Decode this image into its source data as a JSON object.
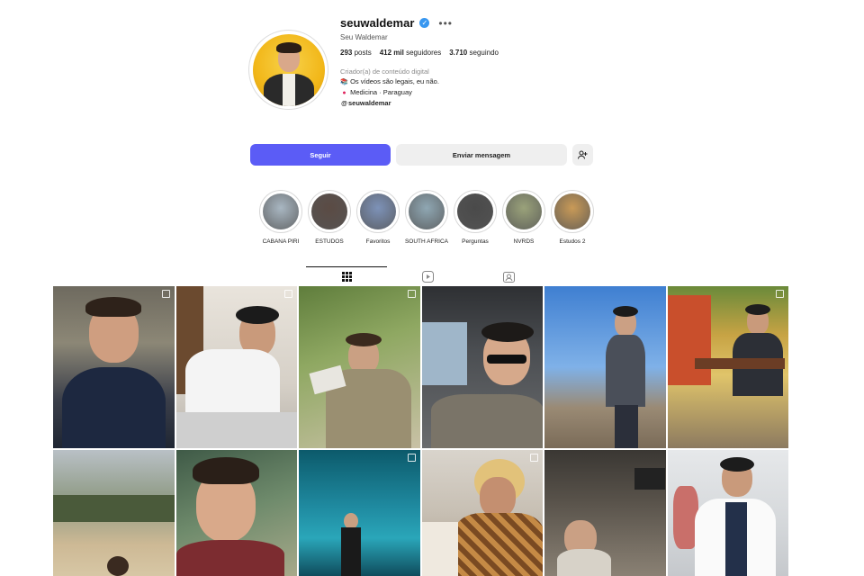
{
  "profile": {
    "username": "seuwaldemar",
    "full_name": "Seu Waldemar",
    "posts_count": "293",
    "posts_label": "posts",
    "followers_count": "412 mil",
    "followers_label": "seguidores",
    "following_count": "3.710",
    "following_label": "seguindo",
    "category": "Criador(a) de conteúdo digital",
    "bio_line1": "Os vídeos são legais, eu não.",
    "bio_line2": "Medicina · Paraguay",
    "threads_handle": "seuwaldemar"
  },
  "actions": {
    "follow_label": "Seguir",
    "message_label": "Enviar mensagem",
    "add_icon": "person-add-icon"
  },
  "highlights": [
    {
      "label": "CABANA PIRI",
      "color": "#a9b7c2"
    },
    {
      "label": "ESTUDOS",
      "color": "#5b4b44"
    },
    {
      "label": "Favoritos",
      "color": "#7d92b8"
    },
    {
      "label": "SOUTH AFRICA",
      "color": "#8fa7b3"
    },
    {
      "label": "Perguntas",
      "color": "#4a4a4a"
    },
    {
      "label": "NVRDS",
      "color": "#9aa27a"
    },
    {
      "label": "Estudos 2",
      "color": "#c99a57"
    }
  ],
  "tabs": [
    {
      "icon": "grid-icon",
      "active": true
    },
    {
      "icon": "reels-icon",
      "active": false
    },
    {
      "icon": "tagged-icon",
      "active": false
    }
  ],
  "colors": {
    "accent": "#5b5cf6",
    "verified": "#3897f0"
  }
}
